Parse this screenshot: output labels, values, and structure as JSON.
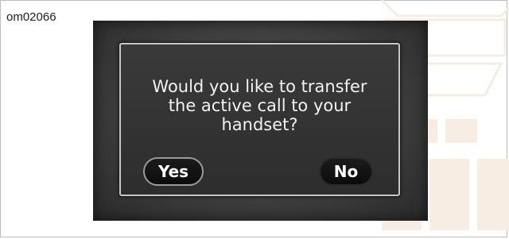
{
  "figure_label": "om02066",
  "dialog": {
    "message": "Would you like to transfer\nthe active call to your\nhandset?",
    "yes_label": "Yes",
    "no_label": "No"
  },
  "colors": {
    "screen_background": "#3e3e3e",
    "dialog_border": "#c8c8c8",
    "button_fill": "#111111",
    "text": "#f2f2f2",
    "watermark": "#f6e9dc"
  }
}
